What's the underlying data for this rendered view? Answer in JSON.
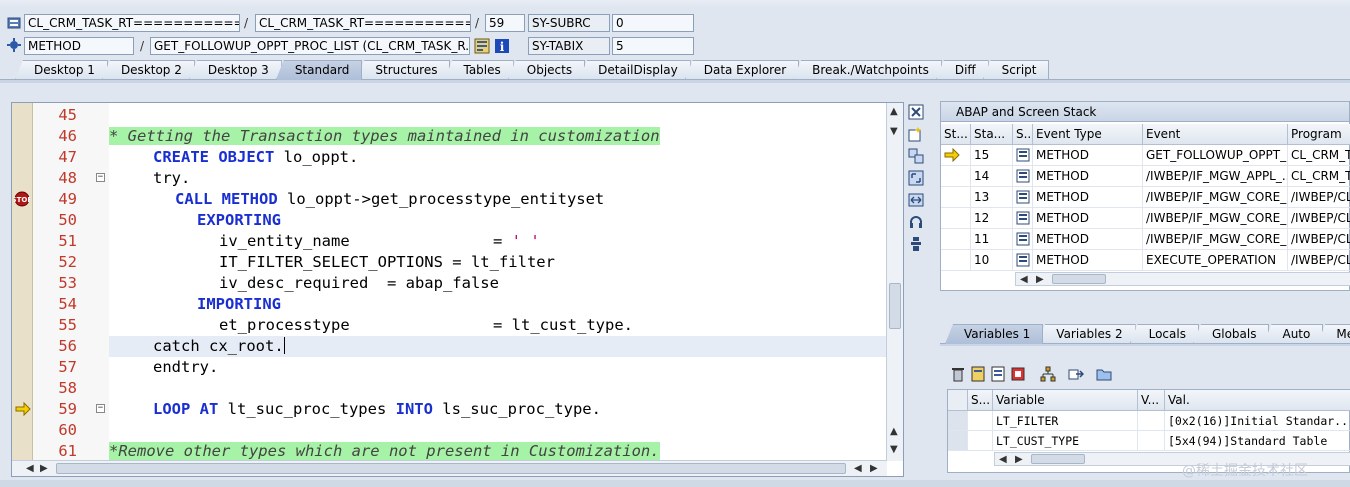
{
  "header": {
    "class_field": "CL_CRM_TASK_RT================",
    "include_field": "CL_CRM_TASK_RT================",
    "line_field": "59",
    "sy_subrc_label": "SY-SUBRC",
    "sy_subrc_value": "0",
    "type_field": "METHOD",
    "event_field": "GET_FOLLOWUP_OPPT_PROC_LIST (CL_CRM_TASK_R...",
    "sy_tabix_label": "SY-TABIX",
    "sy_tabix_value": "5",
    "separator": "/"
  },
  "tabs": [
    {
      "label": "Desktop 1"
    },
    {
      "label": "Desktop 2"
    },
    {
      "label": "Desktop 3"
    },
    {
      "label": "Standard"
    },
    {
      "label": "Structures"
    },
    {
      "label": "Tables"
    },
    {
      "label": "Objects"
    },
    {
      "label": "DetailDisplay"
    },
    {
      "label": "Data Explorer"
    },
    {
      "label": "Break./Watchpoints"
    },
    {
      "label": "Diff"
    },
    {
      "label": "Script"
    }
  ],
  "active_tab": "Standard",
  "code_lines": [
    {
      "n": "45"
    },
    {
      "n": "46"
    },
    {
      "n": "47"
    },
    {
      "n": "48"
    },
    {
      "n": "49"
    },
    {
      "n": "50"
    },
    {
      "n": "51"
    },
    {
      "n": "52"
    },
    {
      "n": "53"
    },
    {
      "n": "54"
    },
    {
      "n": "55"
    },
    {
      "n": "56"
    },
    {
      "n": "57"
    },
    {
      "n": "58"
    },
    {
      "n": "59"
    },
    {
      "n": "60"
    },
    {
      "n": "61"
    }
  ],
  "code": {
    "l46": "* Getting the Transaction types maintained in customization",
    "l47_kw": "CREATE OBJECT",
    "l47_rest": " lo_oppt.",
    "l48": "try.",
    "l49_kw": "CALL METHOD",
    "l49_rest": " lo_oppt->get_processtype_entityset",
    "l50_kw": "EXPORTING",
    "l51_name": "iv_entity_name",
    "l51_eq": "= ",
    "l51_str": "' '",
    "l52": "IT_FILTER_SELECT_OPTIONS = lt_filter",
    "l53": "iv_desc_required  = abap_false",
    "l54_kw": "IMPORTING",
    "l55_name": "et_processtype",
    "l55_rest": "= lt_cust_type.",
    "l56": "catch cx_root.",
    "l57": "endtry.",
    "l59_kw1": "LOOP AT",
    "l59_mid": " lt_suc_proc_types ",
    "l59_kw2": "INTO",
    "l59_rest": " ls_suc_proc_type.",
    "l61": "*Remove other types which are not present in Customization."
  },
  "stack": {
    "title": "ABAP and Screen Stack",
    "columns": [
      "St...",
      "Sta...",
      "S...",
      "Event Type",
      "Event",
      "Program"
    ],
    "rows": [
      {
        "level": "15",
        "type": "METHOD",
        "event": "GET_FOLLOWUP_OPPT_...",
        "program": "CL_CRM_TA"
      },
      {
        "level": "14",
        "type": "METHOD",
        "event": "/IWBEP/IF_MGW_APPL_...",
        "program": "CL_CRM_TA"
      },
      {
        "level": "13",
        "type": "METHOD",
        "event": "/IWBEP/IF_MGW_CORE_...",
        "program": "/IWBEP/CL_"
      },
      {
        "level": "12",
        "type": "METHOD",
        "event": "/IWBEP/IF_MGW_CORE_...",
        "program": "/IWBEP/CL_"
      },
      {
        "level": "11",
        "type": "METHOD",
        "event": "/IWBEP/IF_MGW_CORE_...",
        "program": "/IWBEP/CL_"
      },
      {
        "level": "10",
        "type": "METHOD",
        "event": "EXECUTE_OPERATION",
        "program": "/IWBEP/CL_"
      }
    ]
  },
  "var_tabs": [
    {
      "label": "Variables 1"
    },
    {
      "label": "Variables 2"
    },
    {
      "label": "Locals"
    },
    {
      "label": "Globals"
    },
    {
      "label": "Auto"
    },
    {
      "label": "Mem"
    }
  ],
  "variables": {
    "columns": [
      "S...",
      "Variable",
      "V...",
      "Val."
    ],
    "rows": [
      {
        "name": "LT_FILTER",
        "value": "[0x2(16)]Initial Standar..."
      },
      {
        "name": "LT_CUST_TYPE",
        "value": "[5x4(94)]Standard Table"
      }
    ]
  },
  "watermark": "@稀土掘金技术社区",
  "colors": {
    "keyword": "#1a2fd1",
    "comment_bg": "#a6f2a6",
    "line_number": "#c0392b",
    "active_tab": "#aebfd8"
  }
}
